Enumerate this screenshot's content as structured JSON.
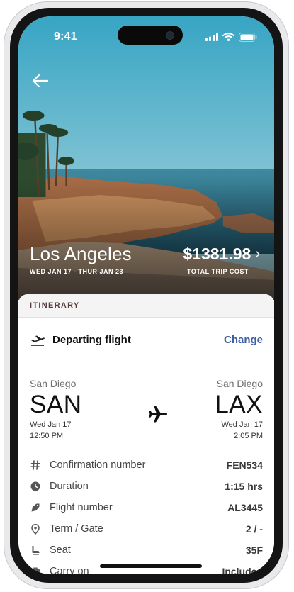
{
  "status_bar": {
    "time": "9:41"
  },
  "hero": {
    "city": "Los Angeles",
    "dates": "WED JAN 17 - THUR JAN 23",
    "price": "$1381.98",
    "price_label": "TOTAL TRIP COST"
  },
  "itinerary": {
    "header": "ITINERARY",
    "departing_title": "Departing flight",
    "change_label": "Change",
    "origin": {
      "city": "San Diego",
      "code": "SAN",
      "date": "Wed Jan 17",
      "time": "12:50 PM"
    },
    "destination": {
      "city": "San Diego",
      "code": "LAX",
      "date": "Wed Jan 17",
      "time": "2:05 PM"
    },
    "details": [
      {
        "icon": "hash-icon",
        "label": "Confirmation number",
        "value": "FEN534"
      },
      {
        "icon": "clock-icon",
        "label": "Duration",
        "value": "1:15 hrs"
      },
      {
        "icon": "tag-icon",
        "label": "Flight number",
        "value": "AL3445"
      },
      {
        "icon": "location-pin-icon",
        "label": "Term / Gate",
        "value": "2 / -"
      },
      {
        "icon": "seat-icon",
        "label": "Seat",
        "value": "35F"
      },
      {
        "icon": "briefcase-icon",
        "label": "Carry on",
        "value": "Included"
      }
    ]
  },
  "colors": {
    "accent": "#3a5fa5",
    "header_text": "#5a3b3b",
    "sheet_header_bg": "#f4f4f5"
  }
}
